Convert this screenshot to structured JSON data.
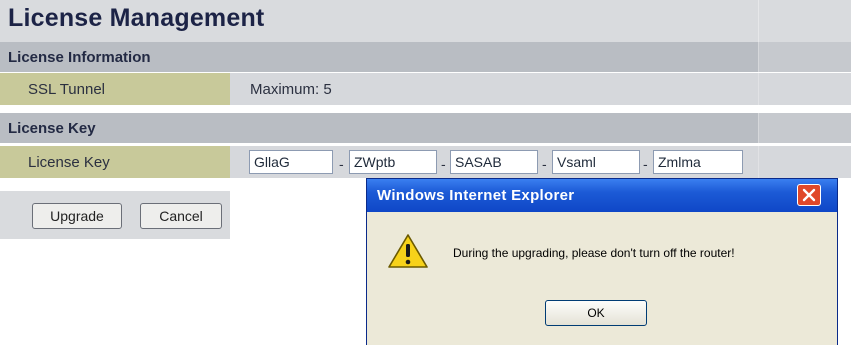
{
  "page": {
    "title": "License Management"
  },
  "sections": {
    "license_information": "License Information",
    "license_key": "License Key"
  },
  "ssl_tunnel": {
    "label": "SSL Tunnel",
    "value": "Maximum: 5"
  },
  "license_key_row": {
    "label": "License Key",
    "separator": "-",
    "fields": [
      "GllaG",
      "ZWptb",
      "SASAB",
      "Vsaml",
      "Zmlma"
    ]
  },
  "buttons": {
    "upgrade": "Upgrade",
    "cancel": "Cancel"
  },
  "dialog": {
    "title": "Windows Internet Explorer",
    "message": "During the upgrading, please don't turn off the router!",
    "ok": "OK",
    "icon": "warning-icon",
    "close_icon": "close-icon"
  },
  "colors": {
    "key_cell": "#c8c99a",
    "section_header": "#b9bdc3",
    "dialog_titlebar": "#0f47c7",
    "close_button": "#e0482a"
  }
}
